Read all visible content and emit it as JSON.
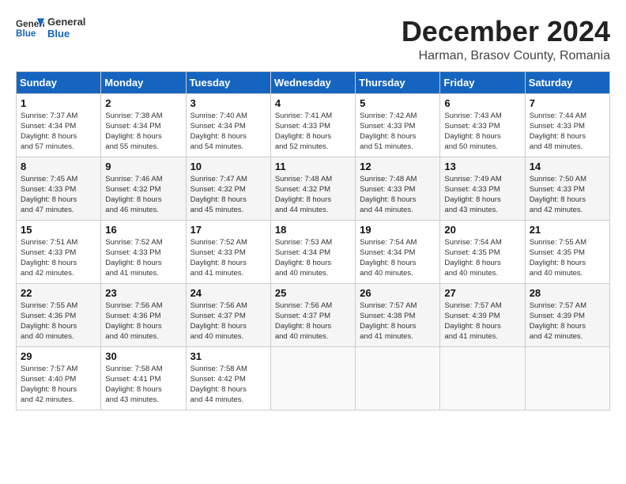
{
  "header": {
    "logo_general": "General",
    "logo_blue": "Blue",
    "month_title": "December 2024",
    "location": "Harman, Brasov County, Romania"
  },
  "calendar": {
    "days_of_week": [
      "Sunday",
      "Monday",
      "Tuesday",
      "Wednesday",
      "Thursday",
      "Friday",
      "Saturday"
    ],
    "weeks": [
      [
        null,
        null,
        null,
        null,
        null,
        null,
        null
      ]
    ],
    "cells": [
      {
        "day": null
      },
      {
        "day": null
      },
      {
        "day": null
      },
      {
        "day": null
      },
      {
        "day": null
      },
      {
        "day": null
      },
      {
        "day": null
      }
    ]
  }
}
